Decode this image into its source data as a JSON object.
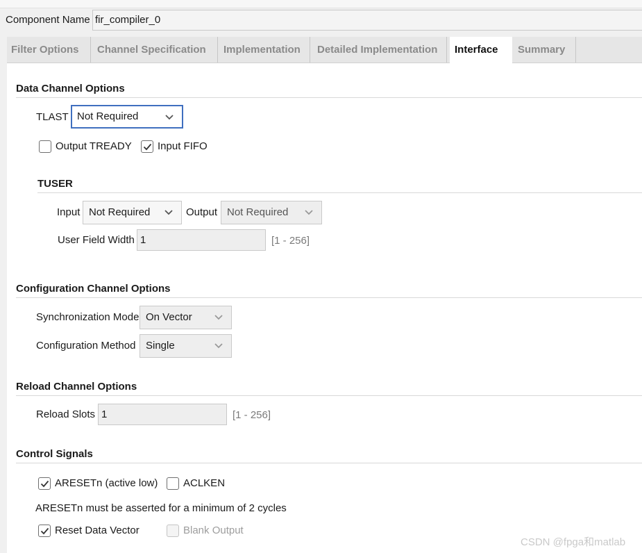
{
  "header": {
    "component_name_label": "Component Name",
    "component_name_value": "fir_compiler_0"
  },
  "tabs": [
    {
      "label": "Filter Options",
      "active": false
    },
    {
      "label": "Channel Specification",
      "active": false
    },
    {
      "label": "Implementation",
      "active": false
    },
    {
      "label": "Detailed Implementation",
      "active": false
    },
    {
      "label": "Interface",
      "active": true
    },
    {
      "label": "Summary",
      "active": false
    }
  ],
  "data_channel": {
    "title": "Data Channel Options",
    "tlast_label": "TLAST",
    "tlast_value": "Not Required",
    "output_tready_label": "Output TREADY",
    "output_tready_checked": false,
    "input_fifo_label": "Input FIFO",
    "input_fifo_checked": true,
    "tuser": {
      "title": "TUSER",
      "input_label": "Input",
      "input_value": "Not Required",
      "output_label": "Output",
      "output_value": "Not Required",
      "user_field_width_label": "User Field Width",
      "user_field_width_value": "1",
      "user_field_width_range": "[1 - 256]"
    }
  },
  "config_channel": {
    "title": "Configuration Channel Options",
    "sync_mode_label": "Synchronization Mode",
    "sync_mode_value": "On Vector",
    "config_method_label": "Configuration Method",
    "config_method_value": "Single"
  },
  "reload_channel": {
    "title": "Reload Channel Options",
    "reload_slots_label": "Reload Slots",
    "reload_slots_value": "1",
    "reload_slots_range": "[1 - 256]"
  },
  "control_signals": {
    "title": "Control Signals",
    "aresetn_label": "ARESETn (active low)",
    "aresetn_checked": true,
    "aclken_label": "ACLKEN",
    "aclken_checked": false,
    "aresetn_note": "ARESETn must be asserted for a minimum of 2 cycles",
    "reset_data_vector_label": "Reset Data Vector",
    "reset_data_vector_checked": true,
    "blank_output_label": "Blank Output",
    "blank_output_checked": false,
    "blank_output_enabled": false
  },
  "watermark": "CSDN @fpga和matlab",
  "colors": {
    "focus_border": "#3f6fbf",
    "panel_background": "#ffffff",
    "tab_bar": "#e6e6e6"
  }
}
